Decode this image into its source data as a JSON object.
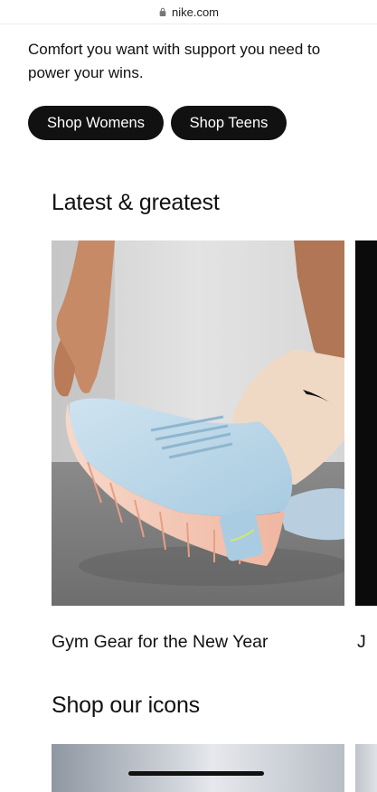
{
  "browser": {
    "url": "nike.com",
    "lock_icon": "lock-icon"
  },
  "hero": {
    "tagline": "Comfort you want with support you need to power your wins."
  },
  "buttons": {
    "shop_womens": "Shop Womens",
    "shop_teens": "Shop Teens"
  },
  "latest": {
    "title": "Latest & greatest",
    "cards": [
      {
        "label": "Gym Gear for the New Year"
      },
      {
        "label": "J"
      }
    ]
  },
  "icons_section": {
    "title": "Shop our icons"
  },
  "colors": {
    "primary": "#111111",
    "background": "#ffffff",
    "button_text": "#ffffff"
  }
}
